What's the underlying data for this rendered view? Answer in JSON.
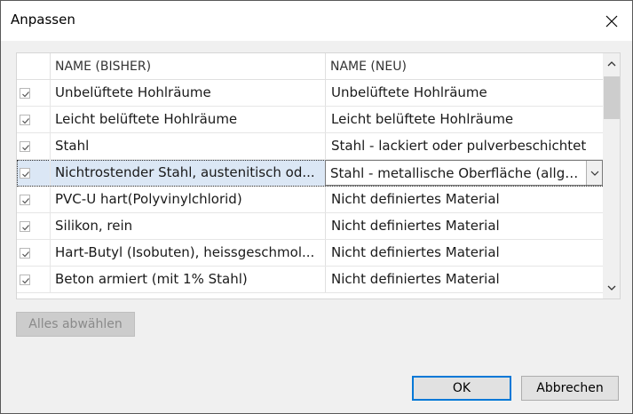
{
  "window": {
    "title": "Anpassen"
  },
  "grid": {
    "columns": [
      "NAME (BISHER)",
      "NAME (NEU)"
    ],
    "rows": [
      {
        "checked": true,
        "old": "Unbelüftete Hohlräume",
        "new": "Unbelüftete Hohlräume",
        "selected": false
      },
      {
        "checked": true,
        "old": "Leicht belüftete Hohlräume",
        "new": "Leicht belüftete Hohlräume",
        "selected": false
      },
      {
        "checked": true,
        "old": "Stahl",
        "new": "Stahl - lackiert oder pulverbeschichtet",
        "selected": false
      },
      {
        "checked": true,
        "old": "Nichtrostender Stahl, austenitisch od...",
        "new": "Stahl - metallische Oberfläche (allge...",
        "selected": true
      },
      {
        "checked": true,
        "old": "PVC-U hart(Polyvinylchlorid)",
        "new": "Nicht definiertes Material",
        "selected": false
      },
      {
        "checked": true,
        "old": "Silikon, rein",
        "new": "Nicht definiertes Material",
        "selected": false
      },
      {
        "checked": true,
        "old": "Hart-Butyl (Isobuten), heissgeschmol...",
        "new": "Nicht definiertes Material",
        "selected": false
      },
      {
        "checked": true,
        "old": "Beton armiert (mit 1% Stahl)",
        "new": "Nicht definiertes Material",
        "selected": false
      }
    ]
  },
  "buttons": {
    "deselect_all": "Alles abwählen",
    "ok": "OK",
    "cancel": "Abbrechen"
  },
  "colors": {
    "accent": "#0078d7",
    "selection": "#dbe7f5"
  },
  "icons": {
    "close": "close-icon",
    "check": "checkmark-icon",
    "dropdown": "chevron-down-icon",
    "scroll_up": "chevron-up-icon",
    "scroll_down": "chevron-down-icon"
  }
}
